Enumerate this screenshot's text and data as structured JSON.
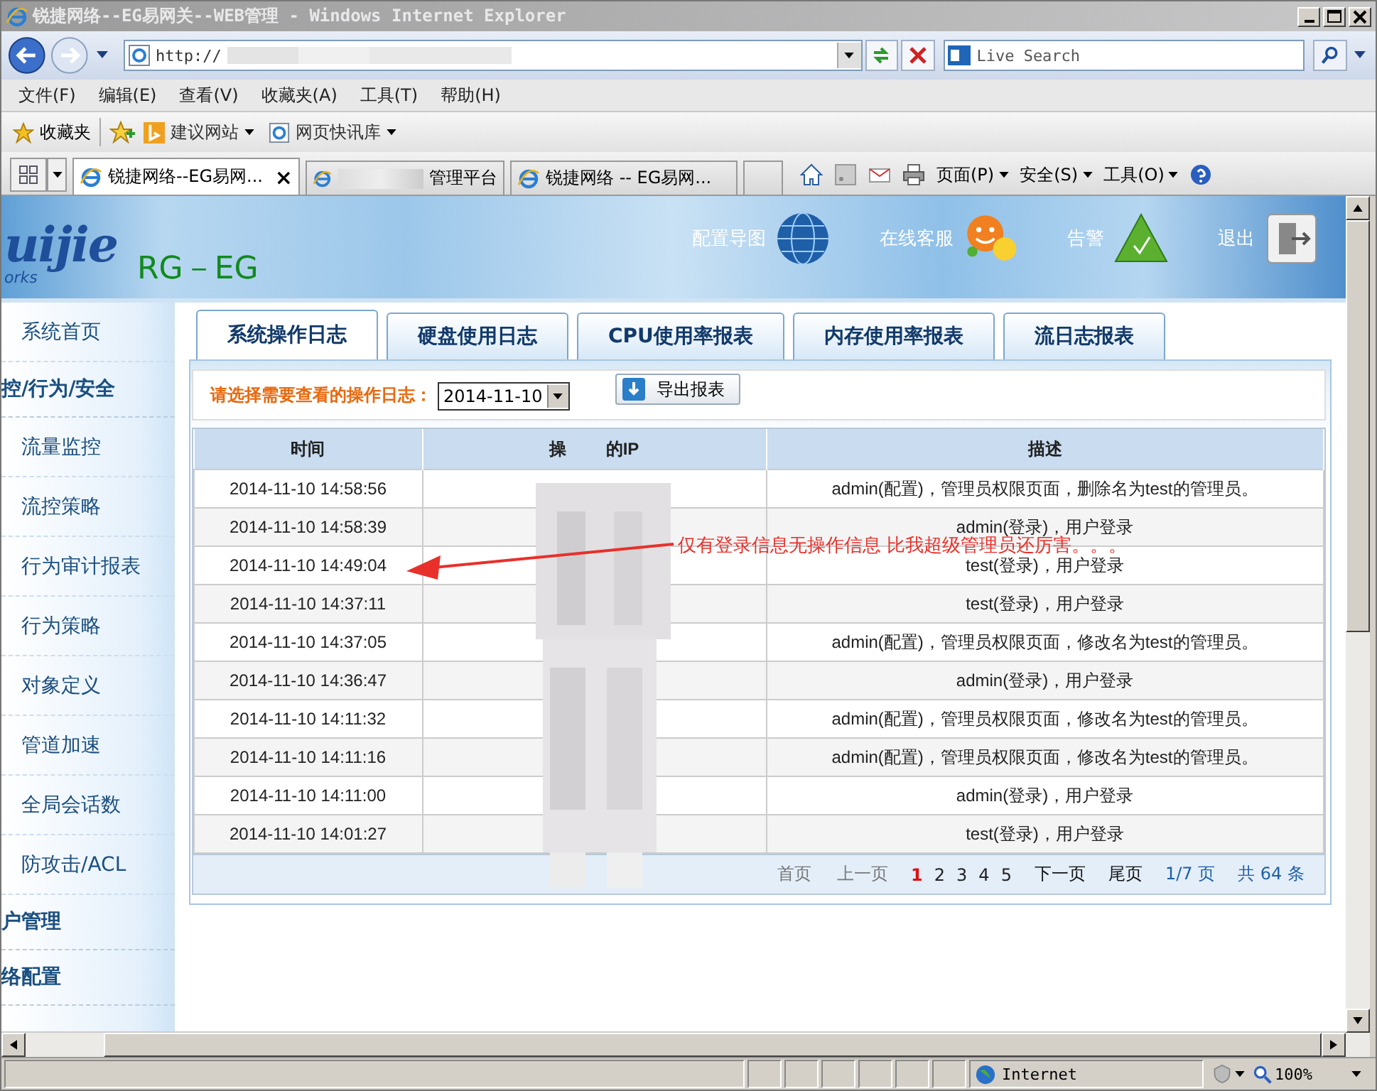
{
  "window": {
    "title": "锐捷网络--EG易网关--WEB管理 - Windows Internet Explorer"
  },
  "address_bar": {
    "value": "http://",
    "search_placeholder": "Live Search"
  },
  "menu": [
    "文件(F)",
    "编辑(E)",
    "查看(V)",
    "收藏夹(A)",
    "工具(T)",
    "帮助(H)"
  ],
  "favorites_bar": {
    "label": "收藏夹",
    "items": [
      {
        "label": "建议网站",
        "kind": "bing"
      },
      {
        "label": "网页快讯库",
        "kind": "ie"
      }
    ]
  },
  "browser_tabs": [
    {
      "label": "锐捷网络--EG易网...",
      "selected": true
    },
    {
      "label": "管理平台",
      "selected": false
    },
    {
      "label": "锐捷网络 -- EG易网...",
      "selected": false
    }
  ],
  "tab_close": "×",
  "command_bar": [
    {
      "label": "页面(P)"
    },
    {
      "label": "安全(S)"
    },
    {
      "label": "工具(O)"
    }
  ],
  "header": {
    "logo": "uijie",
    "logo_sub": "orks",
    "product": "RG－EG",
    "links": [
      {
        "label": "配置导图",
        "kind": "globe"
      },
      {
        "label": "在线客服",
        "kind": "service"
      },
      {
        "label": "告警",
        "kind": "alarm"
      },
      {
        "label": "退出",
        "kind": "exit"
      }
    ]
  },
  "sidebar": [
    {
      "label": "系统首页",
      "kind": "item"
    },
    {
      "label": "控/行为/安全",
      "kind": "section"
    },
    {
      "label": "流量监控",
      "kind": "item"
    },
    {
      "label": "流控策略",
      "kind": "item"
    },
    {
      "label": "行为审计报表",
      "kind": "item"
    },
    {
      "label": "行为策略",
      "kind": "item"
    },
    {
      "label": "对象定义",
      "kind": "item"
    },
    {
      "label": "管道加速",
      "kind": "item"
    },
    {
      "label": "全局会话数",
      "kind": "item"
    },
    {
      "label": "防攻击/ACL",
      "kind": "item"
    },
    {
      "label": "户管理",
      "kind": "section"
    },
    {
      "label": "络配置",
      "kind": "section"
    }
  ],
  "report_tabs": [
    {
      "label": "系统操作日志",
      "selected": true
    },
    {
      "label": "硬盘使用日志",
      "selected": false
    },
    {
      "label": "CPU使用率报表",
      "selected": false
    },
    {
      "label": "内存使用率报表",
      "selected": false
    },
    {
      "label": "流日志报表",
      "selected": false
    }
  ],
  "filter": {
    "label": "请选择需要查看的操作日志：",
    "date": "2014-11-10",
    "export": "导出报表"
  },
  "table": {
    "columns": [
      {
        "parts": [
          "时间"
        ]
      },
      {
        "parts": [
          "操",
          "的IP"
        ]
      },
      {
        "parts": [
          "描述"
        ]
      }
    ],
    "rows": [
      {
        "time": "2014-11-10 14:58:56",
        "description": "admin(配置)，管理员权限页面，删除名为test的管理员。"
      },
      {
        "time": "2014-11-10 14:58:39",
        "description": "admin(登录)，用户登录"
      },
      {
        "time": "2014-11-10 14:49:04",
        "description": "test(登录)，用户登录"
      },
      {
        "time": "2014-11-10 14:37:11",
        "description": "test(登录)，用户登录"
      },
      {
        "time": "2014-11-10 14:37:05",
        "description": "admin(配置)，管理员权限页面，修改名为test的管理员。"
      },
      {
        "time": "2014-11-10 14:36:47",
        "description": "admin(登录)，用户登录"
      },
      {
        "time": "2014-11-10 14:11:32",
        "description": "admin(配置)，管理员权限页面，修改名为test的管理员。"
      },
      {
        "time": "2014-11-10 14:11:16",
        "description": "admin(配置)，管理员权限页面，修改名为test的管理员。"
      },
      {
        "time": "2014-11-10 14:11:00",
        "description": "admin(登录)，用户登录"
      },
      {
        "time": "2014-11-10 14:01:27",
        "description": "test(登录)，用户登录"
      }
    ]
  },
  "pagination": {
    "first": "首页",
    "prev": "上一页",
    "pages": [
      {
        "label": "1",
        "selected": true
      },
      {
        "label": "2",
        "selected": false
      },
      {
        "label": "3",
        "selected": false
      },
      {
        "label": "4",
        "selected": false
      },
      {
        "label": "5",
        "selected": false
      }
    ],
    "next": "下一页",
    "last": "尾页",
    "summary": "1/7 页",
    "total": "共 64 条"
  },
  "annotation": "仅有登录信息无操作信息 比我超级管理员还厉害。。。",
  "status_bar": {
    "zone": "Internet",
    "zoom": "100%"
  }
}
